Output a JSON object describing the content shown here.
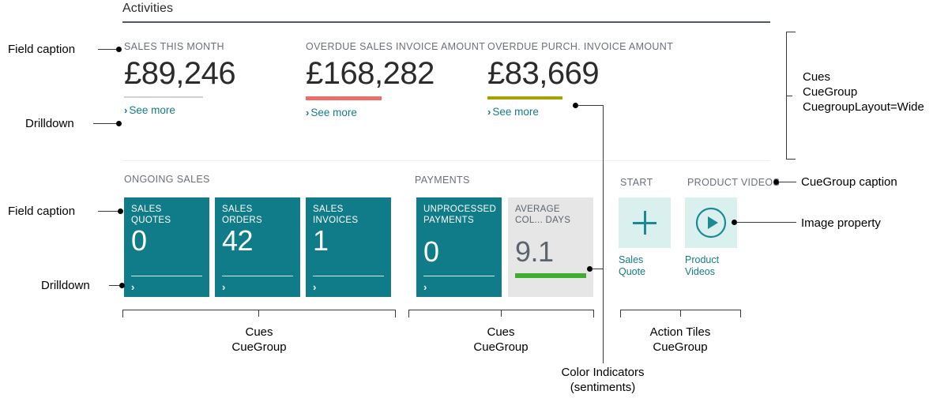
{
  "page": {
    "title": "Activities"
  },
  "colors": {
    "tile_teal": "#107C89",
    "tile_gray": "#e6e6e6",
    "action_tile_bg": "#d9f0ef",
    "link_teal": "#137b86",
    "sentiment_neutral": "#d0d0d0",
    "sentiment_unfavorable": "#EE6D66",
    "sentiment_ambiguous": "#A8A000",
    "sentiment_favorable": "#3DAE2B",
    "caption_gray": "#6a6f7a",
    "title_rule": "#50596b"
  },
  "wide_cues": {
    "caption_row": "Cues",
    "items": [
      {
        "caption": "SALES THIS MONTH",
        "value": "£89,246",
        "sentiment": "neutral",
        "sentiment_color": "#d0d0d0",
        "drilldown": "See more",
        "chevron": "›"
      },
      {
        "caption": "OVERDUE SALES INVOICE AMOUNT",
        "value": "£168,282",
        "sentiment": "unfavorable",
        "sentiment_color": "#EE6D66",
        "drilldown": "See more",
        "chevron": "›"
      },
      {
        "caption": "OVERDUE PURCH. INVOICE AMOUNT",
        "value": "£83,669",
        "sentiment": "ambiguous",
        "sentiment_color": "#A8A000",
        "drilldown": "See more",
        "chevron": "›"
      }
    ]
  },
  "groups": {
    "ongoing_sales": {
      "caption": "ONGOING SALES",
      "tiles": [
        {
          "caption": "SALES QUOTES",
          "value": "0",
          "chevron": "›"
        },
        {
          "caption": "SALES ORDERS",
          "value": "42",
          "chevron": "›"
        },
        {
          "caption": "SALES INVOICES",
          "value": "1",
          "chevron": "›"
        }
      ]
    },
    "payments": {
      "caption": "PAYMENTS",
      "tiles": [
        {
          "caption": "UNPROCESSED PAYMENTS",
          "value": "0",
          "chevron": "›"
        },
        {
          "caption": "AVERAGE COL... DAYS",
          "value": "9.1",
          "bar_color": "#3DAE2B"
        }
      ]
    },
    "start": {
      "caption": "START",
      "tiles": [
        {
          "label": "Sales Quote",
          "icon": "plus-icon"
        }
      ]
    },
    "product_videos": {
      "caption": "PRODUCT VIDEOS",
      "tiles": [
        {
          "label": "Product Videos",
          "icon": "play-circle-icon"
        }
      ]
    }
  },
  "annotations": {
    "field_caption_top": "Field caption",
    "drilldown_top": "Drilldown",
    "field_caption_bottom": "Field caption",
    "drilldown_bottom": "Drilldown",
    "cues_wide": "Cues\nCueGroup\nCuegroupLayout=Wide",
    "cues_wide_l1": "Cues",
    "cues_wide_l2": "CueGroup",
    "cues_wide_l3": "CuegroupLayout=Wide",
    "cuegroup_caption": "CueGroup caption",
    "image_property": "Image property",
    "cues_cuegroup_1_l1": "Cues",
    "cues_cuegroup_1_l2": "CueGroup",
    "cues_cuegroup_2_l1": "Cues",
    "cues_cuegroup_2_l2": "CueGroup",
    "action_tiles_l1": "Action Tiles",
    "action_tiles_l2": "CueGroup",
    "color_indicators_l1": "Color Indicators",
    "color_indicators_l2": "(sentiments)"
  }
}
